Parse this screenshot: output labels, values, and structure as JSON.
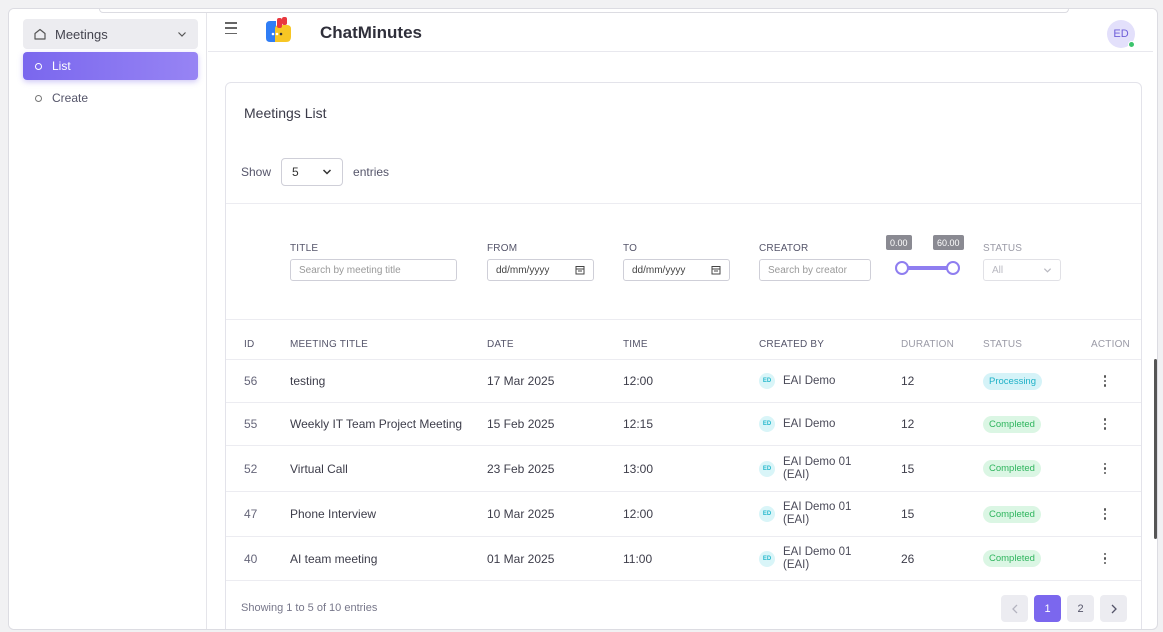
{
  "sidebar": {
    "group_label": "Meetings",
    "items": [
      {
        "label": "List",
        "active": true
      },
      {
        "label": "Create",
        "active": false
      }
    ]
  },
  "header": {
    "title": "ChatMinutes",
    "avatar_initials": "ED"
  },
  "card": {
    "title": "Meetings List",
    "show_prefix": "Show",
    "show_value": "5",
    "show_suffix": "entries"
  },
  "filters": {
    "title_label": "TITLE",
    "title_placeholder": "Search by meeting title",
    "from_label": "FROM",
    "from_value": "dd/mm/yyyy",
    "to_label": "TO",
    "to_value": "dd/mm/yyyy",
    "creator_label": "CREATOR",
    "creator_placeholder": "Search by creator",
    "duration_min": "0.00",
    "duration_max": "60.00",
    "status_label": "STATUS",
    "status_value": "All"
  },
  "table": {
    "headers": [
      "ID",
      "MEETING TITLE",
      "DATE",
      "TIME",
      "CREATED BY",
      "DURATION",
      "STATUS",
      "ACTION"
    ],
    "rows": [
      {
        "id": "56",
        "title": "testing",
        "date": "17 Mar 2025",
        "time": "12:00",
        "creator_initials": "ED",
        "creator_line1": "EAI Demo",
        "creator_line2": "",
        "duration": "12",
        "status": "Processing"
      },
      {
        "id": "55",
        "title": "Weekly IT Team Project Meeting",
        "date": "15 Feb 2025",
        "time": "12:15",
        "creator_initials": "ED",
        "creator_line1": "EAI Demo",
        "creator_line2": "",
        "duration": "12",
        "status": "Completed"
      },
      {
        "id": "52",
        "title": "Virtual Call",
        "date": "23 Feb 2025",
        "time": "13:00",
        "creator_initials": "ED",
        "creator_line1": "EAI Demo 01",
        "creator_line2": "(EAI)",
        "duration": "15",
        "status": "Completed"
      },
      {
        "id": "47",
        "title": "Phone Interview",
        "date": "10 Mar 2025",
        "time": "12:00",
        "creator_initials": "ED",
        "creator_line1": "EAI Demo 01",
        "creator_line2": "(EAI)",
        "duration": "15",
        "status": "Completed"
      },
      {
        "id": "40",
        "title": "AI team meeting",
        "date": "01 Mar 2025",
        "time": "11:00",
        "creator_initials": "ED",
        "creator_line1": "EAI Demo 01",
        "creator_line2": "(EAI)",
        "duration": "26",
        "status": "Completed"
      }
    ]
  },
  "footer": {
    "showing_text": "Showing 1 to 5 of 10 entries",
    "pages": [
      "1",
      "2"
    ],
    "current_page": "1"
  },
  "colors": {
    "accent": "#7b67ee",
    "processing": "#1fb1c7",
    "completed": "#2fb55e"
  }
}
